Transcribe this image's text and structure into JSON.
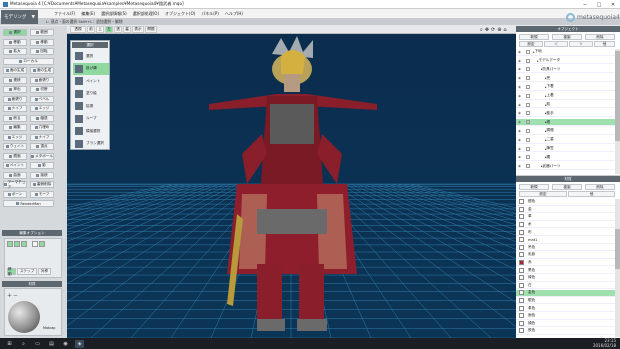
{
  "window": {
    "title": "Metasequoia 4 [C:¥Documents¥Metasequoia¥samples¥Metasequoia4¥鎧武者.mqo]",
    "minimize": "─",
    "maximize": "□",
    "close": "✕"
  },
  "menu": [
    "ファイル(F)",
    "編集(E)",
    "選択部情報(S)",
    "選択部処理(O)",
    "オブジェクト(O)",
    "パネル(P)",
    "ヘルプ(H)"
  ],
  "mode": {
    "label": "モデリング",
    "arrow": "▼"
  },
  "hint": "L: 頂点・面の選択 Shift+L：追加選択・解除",
  "logo_text": "metasequoia4",
  "view_tools": [
    "透視",
    "前",
    "上",
    "左",
    "透",
    "裏",
    "表示",
    "問題"
  ],
  "view_tool_active": 3,
  "left_commands": [
    [
      "選択",
      "範囲"
    ],
    [
      "移動",
      "移動"
    ],
    [
      "拡大",
      "回転"
    ],
    [
      "ローカル",
      ""
    ],
    [
      "面の生成",
      "面の生成"
    ],
    [
      "連続",
      "面張り"
    ],
    [
      "押出",
      "切断"
    ],
    [
      "面張り",
      "ベベル"
    ],
    [
      "ナイフ",
      "エッジ"
    ],
    [
      "削る",
      "縮退"
    ],
    [
      "編集",
      "穴埋め"
    ],
    [
      "エッジ",
      "ナイフ"
    ],
    [
      "ウェイト",
      "頂点"
    ],
    [
      "鏡面",
      "メタボール"
    ],
    [
      "ペイント",
      "影"
    ],
    [
      "曲面",
      "接続"
    ],
    [
      "アーマチュア",
      "裏側削除"
    ],
    [
      "ボーン",
      "モーフ"
    ],
    [
      "RenderMan",
      ""
    ]
  ],
  "edit_option": {
    "title": "編集オプション",
    "buttons": [
      "ステップ",
      "対称"
    ],
    "active": "移動"
  },
  "material_preview": {
    "title": "材質",
    "label": "Matcap"
  },
  "select_popup": {
    "title": "選択",
    "items": [
      "選択",
      "投げ縄",
      "ペイント",
      "塗り絵",
      "拡張",
      "ループ",
      "隣接選択",
      "ブラシ選択"
    ],
    "active": 1
  },
  "object_panel": {
    "title": "オブジェクト",
    "buttons": [
      "新規",
      "複製",
      "削除"
    ],
    "buttons2": [
      "設定",
      "＜",
      "＞",
      "他"
    ],
    "rows": [
      {
        "name": "下地",
        "indent": 0
      },
      {
        "name": "モデルデータ",
        "indent": 1
      },
      {
        "name": "防具パーツ",
        "indent": 2
      },
      {
        "name": "兜",
        "indent": 3
      },
      {
        "name": "下着",
        "indent": 3
      },
      {
        "name": "上着",
        "indent": 3
      },
      {
        "name": "肌",
        "indent": 3
      },
      {
        "name": "籠手",
        "indent": 3
      },
      {
        "name": "鎧",
        "indent": 3
      },
      {
        "name": "胴鎧",
        "indent": 3
      },
      {
        "name": "二重",
        "indent": 3
      },
      {
        "name": "陣笠",
        "indent": 3
      },
      {
        "name": "臑",
        "indent": 3
      },
      {
        "name": "武器パーツ",
        "indent": 2
      }
    ],
    "selected_index": 8
  },
  "material_panel": {
    "title": "材質",
    "buttons": [
      "新規",
      "複製",
      "削除"
    ],
    "buttons2": [
      "設定",
      "他"
    ],
    "rows": [
      {
        "name": "鎧色",
        "color": "#ffffff"
      },
      {
        "name": "金",
        "color": "#ffffff"
      },
      {
        "name": "革",
        "color": "#ffffff"
      },
      {
        "name": "糸",
        "color": "#ffffff"
      },
      {
        "name": "布",
        "color": "#ffffff"
      },
      {
        "name": "mat1",
        "color": "#ffffff"
      },
      {
        "name": "吊色",
        "color": "#ffffff"
      },
      {
        "name": "乳鋲",
        "color": "#ffffff"
      },
      {
        "name": "赤",
        "color": "#b0203a"
      },
      {
        "name": "黒色",
        "color": "#ffffff"
      },
      {
        "name": "緑色",
        "color": "#ffffff"
      },
      {
        "name": "白",
        "color": "#ffffff"
      },
      {
        "name": "金色",
        "color": "#ffffff"
      },
      {
        "name": "銀色",
        "color": "#ffffff"
      },
      {
        "name": "革色",
        "color": "#ffffff"
      },
      {
        "name": "面色",
        "color": "#ffffff"
      },
      {
        "name": "顔色",
        "color": "#ffffff"
      },
      {
        "name": "鉄色",
        "color": "#ffffff"
      }
    ],
    "selected_index": 12
  },
  "taskbar": {
    "time": "23:15",
    "date": "2016/02/18"
  },
  "colors": {
    "accent": "#8fd9a0",
    "header": "#5c6770",
    "viewport": "#0a2a4a",
    "grid": "#3a8fc0"
  }
}
